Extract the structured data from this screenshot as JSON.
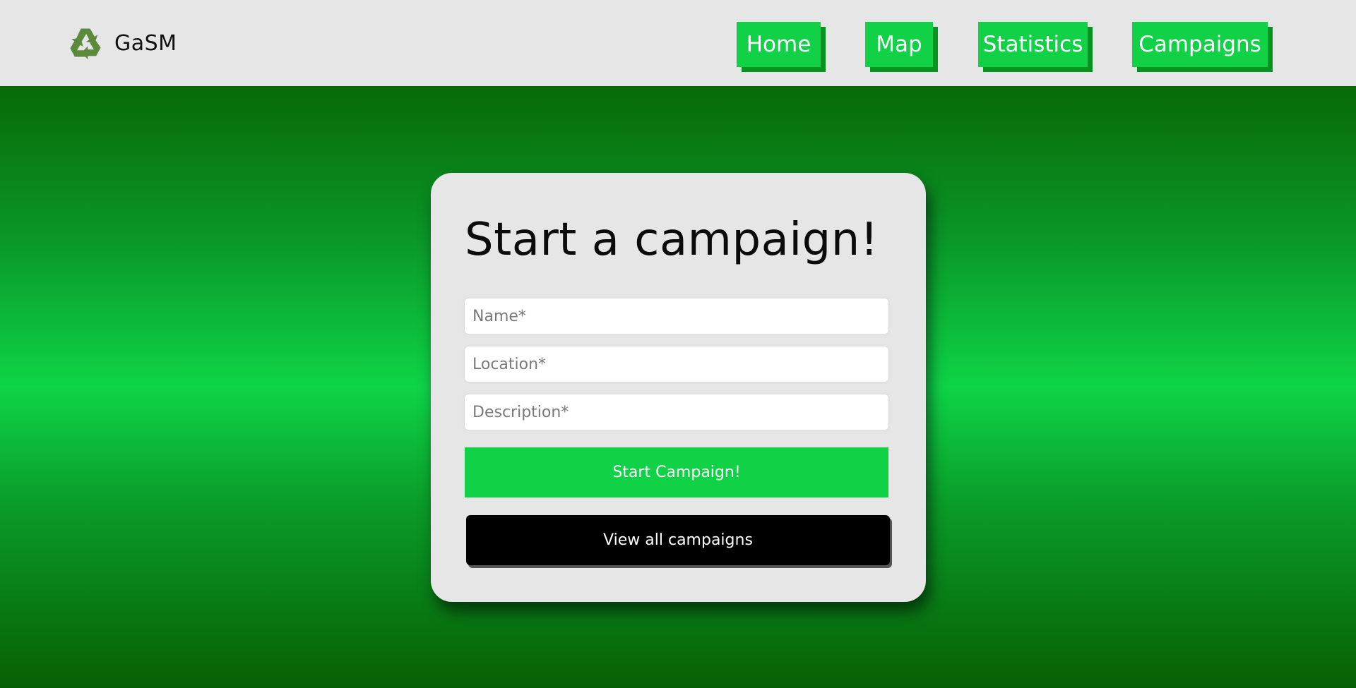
{
  "brand": {
    "name": "GaSM",
    "logo_icon": "recycle-icon",
    "logo_color": "#5b8a3c"
  },
  "nav": {
    "items": [
      {
        "label": "Home"
      },
      {
        "label": "Map"
      },
      {
        "label": "Statistics"
      },
      {
        "label": "Campaigns"
      }
    ]
  },
  "form": {
    "title": "Start a campaign!",
    "name_placeholder": "Name*",
    "location_placeholder": "Location*",
    "description_placeholder": "Description*",
    "submit_label": "Start Campaign!",
    "view_all_label": "View all campaigns"
  },
  "colors": {
    "accent": "#11d147",
    "accent_shadow": "#06931f",
    "header_bg": "#e6e6e6",
    "card_bg": "#e6e6e6",
    "dark_button": "#000000"
  }
}
